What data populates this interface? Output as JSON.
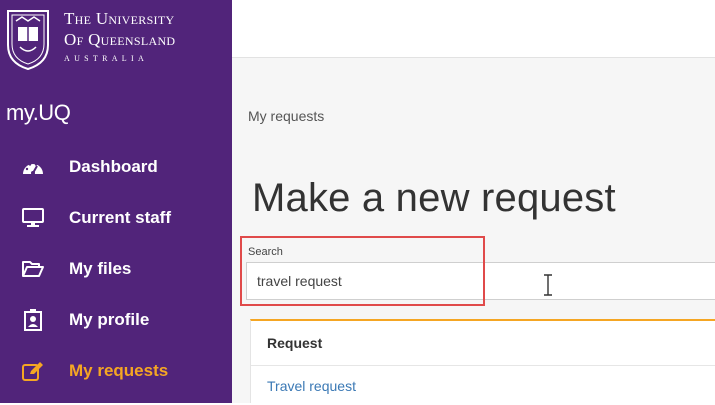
{
  "logo": {
    "line1": "The University",
    "line2": "Of Queensland",
    "line3": "AUSTRALIA"
  },
  "app": {
    "brand": "my.UQ"
  },
  "sidebar": {
    "items": [
      {
        "label": "Dashboard",
        "icon": "dashboard-gauge-icon",
        "active": false
      },
      {
        "label": "Current staff",
        "icon": "monitor-icon",
        "active": false
      },
      {
        "label": "My files",
        "icon": "folder-open-icon",
        "active": false
      },
      {
        "label": "My profile",
        "icon": "id-badge-icon",
        "active": false
      },
      {
        "label": "My requests",
        "icon": "edit-icon",
        "active": true
      }
    ]
  },
  "main": {
    "breadcrumb": "My requests",
    "title": "Make a new request",
    "search": {
      "label": "Search",
      "value": "travel request"
    },
    "results": {
      "header": "Request",
      "rows": [
        {
          "label": "Travel request"
        }
      ]
    }
  },
  "colors": {
    "sidebar_bg": "#51247a",
    "active_accent": "#f5a623",
    "link": "#3b79b5",
    "highlight_box": "#e04a4a"
  }
}
